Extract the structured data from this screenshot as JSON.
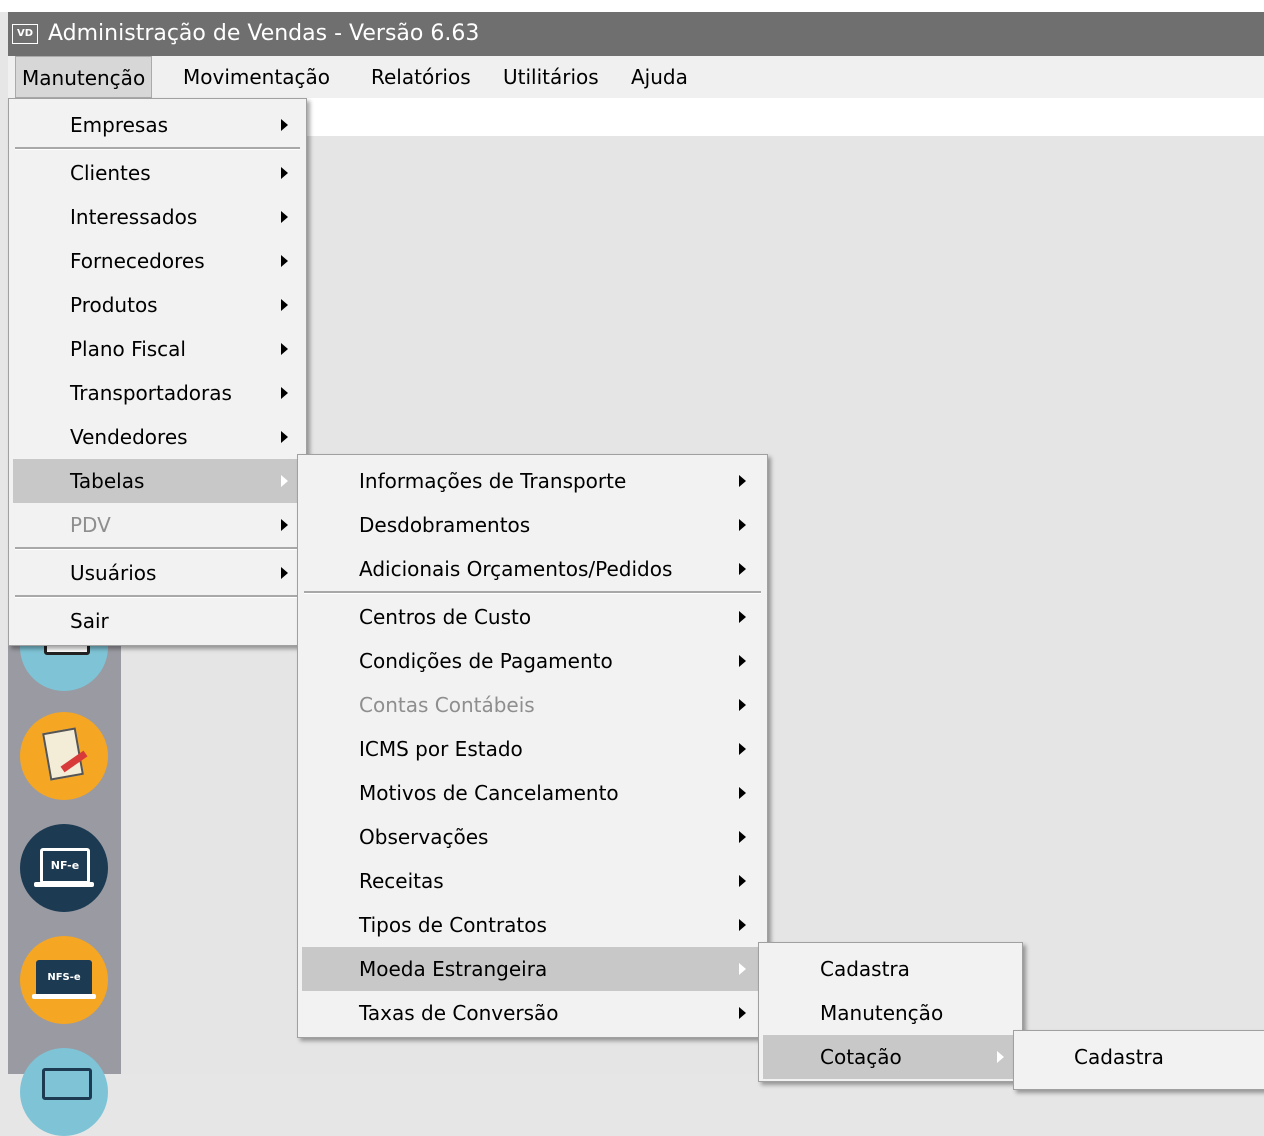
{
  "window": {
    "icon_text": "VD",
    "title": "Administração de Vendas - Versão 6.63"
  },
  "menubar": {
    "items": [
      {
        "label": "Manutenção"
      },
      {
        "label": "Movimentação"
      },
      {
        "label": "Relatórios"
      },
      {
        "label": "Utilitários"
      },
      {
        "label": "Ajuda"
      }
    ]
  },
  "menu_manutencao": {
    "items": [
      {
        "label": "Empresas"
      },
      {
        "label": "Clientes"
      },
      {
        "label": "Interessados"
      },
      {
        "label": "Fornecedores"
      },
      {
        "label": "Produtos"
      },
      {
        "label": "Plano Fiscal"
      },
      {
        "label": "Transportadoras"
      },
      {
        "label": "Vendedores"
      },
      {
        "label": "Tabelas"
      },
      {
        "label": "PDV"
      },
      {
        "label": "Usuários"
      },
      {
        "label": "Sair"
      }
    ]
  },
  "menu_tabelas": {
    "items": [
      {
        "label": "Informações de Transporte"
      },
      {
        "label": "Desdobramentos"
      },
      {
        "label": "Adicionais Orçamentos/Pedidos"
      },
      {
        "label": "Centros de Custo"
      },
      {
        "label": "Condições de Pagamento"
      },
      {
        "label": "Contas Contábeis"
      },
      {
        "label": "ICMS por Estado"
      },
      {
        "label": "Motivos de Cancelamento"
      },
      {
        "label": "Observações"
      },
      {
        "label": "Receitas"
      },
      {
        "label": "Tipos de Contratos"
      },
      {
        "label": "Moeda Estrangeira"
      },
      {
        "label": "Taxas de Conversão"
      }
    ]
  },
  "menu_moeda": {
    "items": [
      {
        "label": "Cadastra"
      },
      {
        "label": "Manutenção"
      },
      {
        "label": "Cotação"
      }
    ]
  },
  "menu_cotacao": {
    "items": [
      {
        "label": "Cadastra"
      }
    ]
  },
  "sidebar": {
    "icons": [
      {
        "name": "list-icon",
        "text": ""
      },
      {
        "name": "contract-edit-icon",
        "text": ""
      },
      {
        "name": "nfe-icon",
        "text": "NF-e"
      },
      {
        "name": "nfse-icon",
        "text": "NFS-e"
      },
      {
        "name": "monitor-icon",
        "text": ""
      }
    ],
    "colors": {
      "teal": "#7ec4d6",
      "orange": "#f5a623",
      "dark": "#1c3a52"
    }
  }
}
